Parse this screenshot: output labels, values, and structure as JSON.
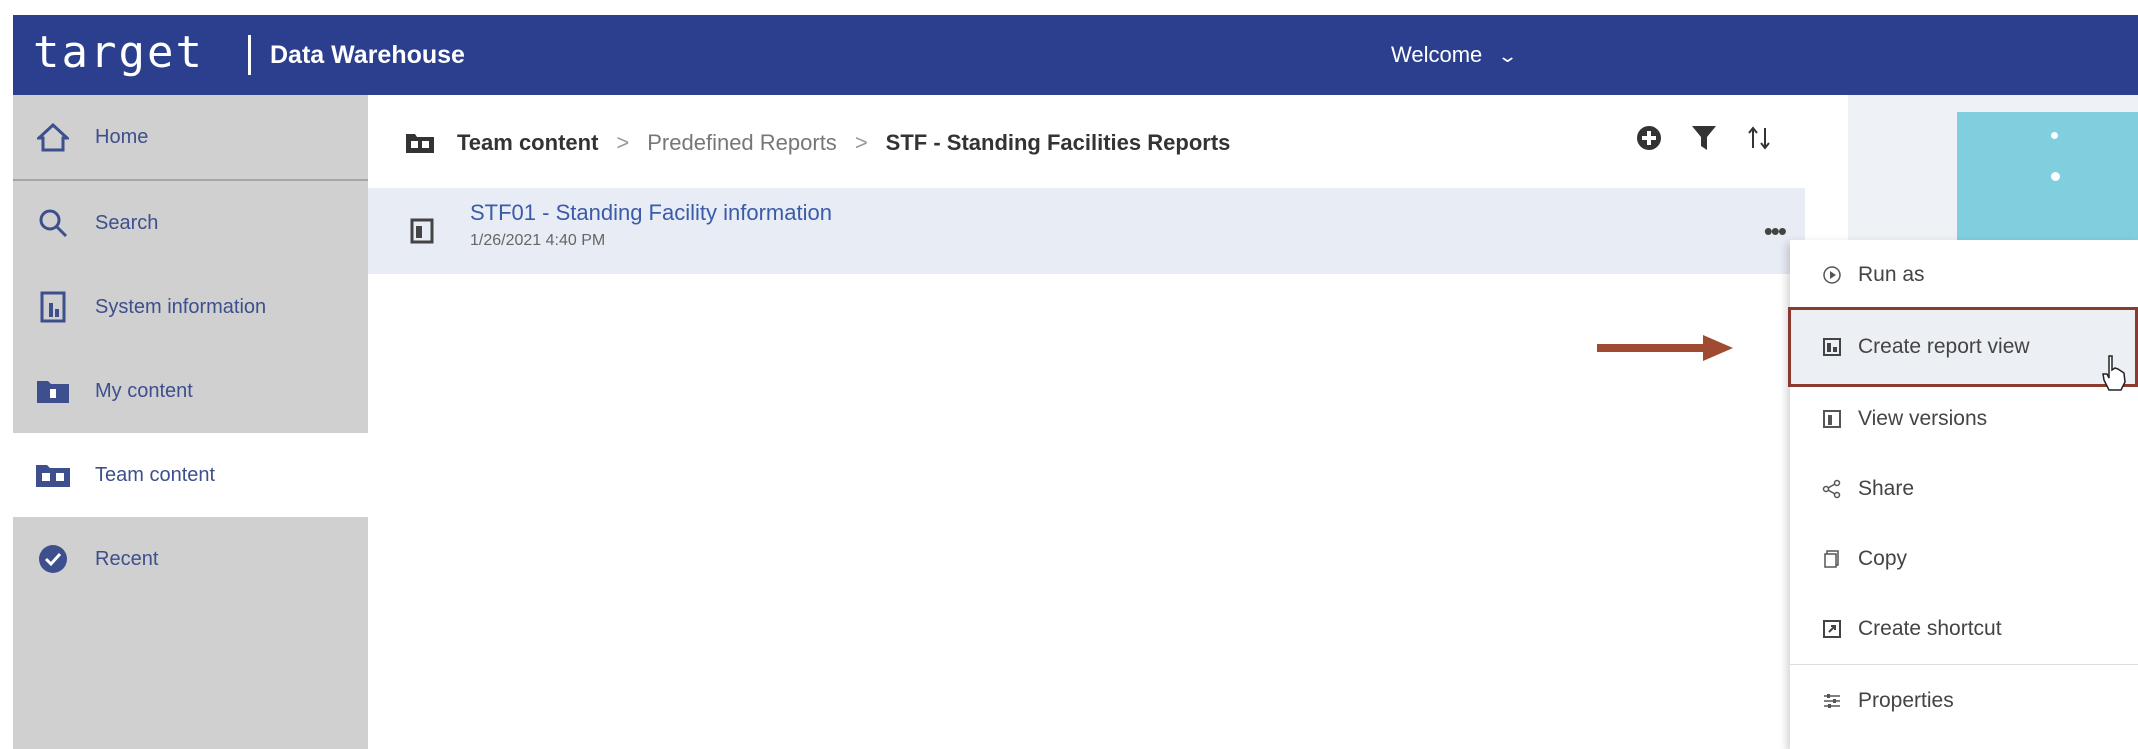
{
  "header": {
    "logo_text": "target",
    "app_title": "Data Warehouse",
    "welcome_label": "Welcome"
  },
  "sidebar": {
    "items": [
      {
        "label": "Home",
        "icon": "home-icon"
      },
      {
        "label": "Search",
        "icon": "search-icon"
      },
      {
        "label": "System information",
        "icon": "system-info-icon"
      },
      {
        "label": "My content",
        "icon": "my-folder-icon"
      },
      {
        "label": "Team content",
        "icon": "team-folder-icon"
      },
      {
        "label": "Recent",
        "icon": "recent-icon"
      }
    ]
  },
  "breadcrumb": {
    "items": [
      "Team content",
      "Predefined Reports",
      "STF - Standing Facilities Reports"
    ]
  },
  "list": {
    "rows": [
      {
        "title": "STF01 - Standing Facility information",
        "date": "1/26/2021 4:40 PM"
      }
    ]
  },
  "context_menu": {
    "items": [
      {
        "label": "Run as",
        "icon": "run-icon"
      },
      {
        "label": "Create report view",
        "icon": "report-view-icon"
      },
      {
        "label": "View versions",
        "icon": "versions-icon"
      },
      {
        "label": "Share",
        "icon": "share-icon"
      },
      {
        "label": "Copy",
        "icon": "copy-icon"
      },
      {
        "label": "Create shortcut",
        "icon": "shortcut-icon"
      },
      {
        "label": "Properties",
        "icon": "properties-icon"
      }
    ]
  },
  "colors": {
    "header_bg": "#2b3f8e",
    "sidebar_bg": "#d0d0d0",
    "link_blue": "#3b5ba8",
    "highlight": "#8b3a2e",
    "teal_tile": "#7fcfdf"
  }
}
